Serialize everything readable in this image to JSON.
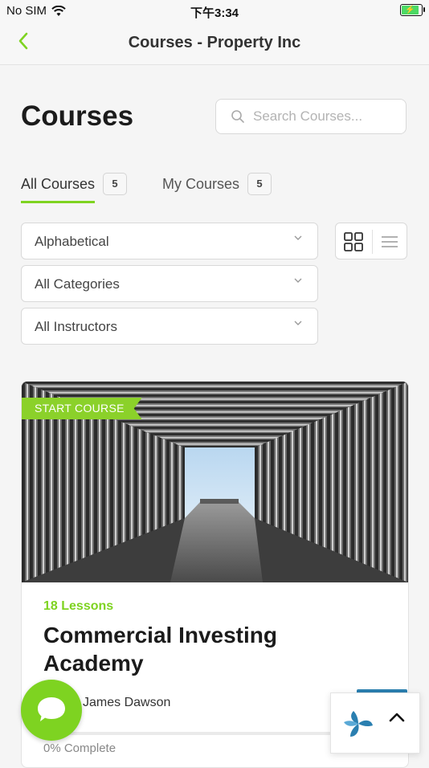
{
  "status_bar": {
    "carrier": "No SIM",
    "time": "下午3:34",
    "battery_color": "#4cd964"
  },
  "nav": {
    "back_icon": "chevron-left-icon",
    "title": "Courses - Property Inc"
  },
  "page": {
    "title": "Courses"
  },
  "search": {
    "placeholder": "Search Courses..."
  },
  "tabs": [
    {
      "label": "All Courses",
      "count": "5",
      "active": true
    },
    {
      "label": "My Courses",
      "count": "5",
      "active": false
    }
  ],
  "filters": {
    "sort": "Alphabetical",
    "category": "All Categories",
    "instructor": "All Instructors"
  },
  "view_toggle": {
    "grid_icon": "grid-view-icon",
    "list_icon": "list-view-icon",
    "active": "grid"
  },
  "course": {
    "ribbon": "START COURSE",
    "lessons": "18 Lessons",
    "title": "Commercial Investing Academy",
    "author": "James Dawson",
    "progress": 0,
    "progress_text": "0% Complete"
  },
  "colors": {
    "accent": "#7ed321",
    "ribbon": "#8bd12a",
    "widget_accent": "#2a7fb0"
  }
}
